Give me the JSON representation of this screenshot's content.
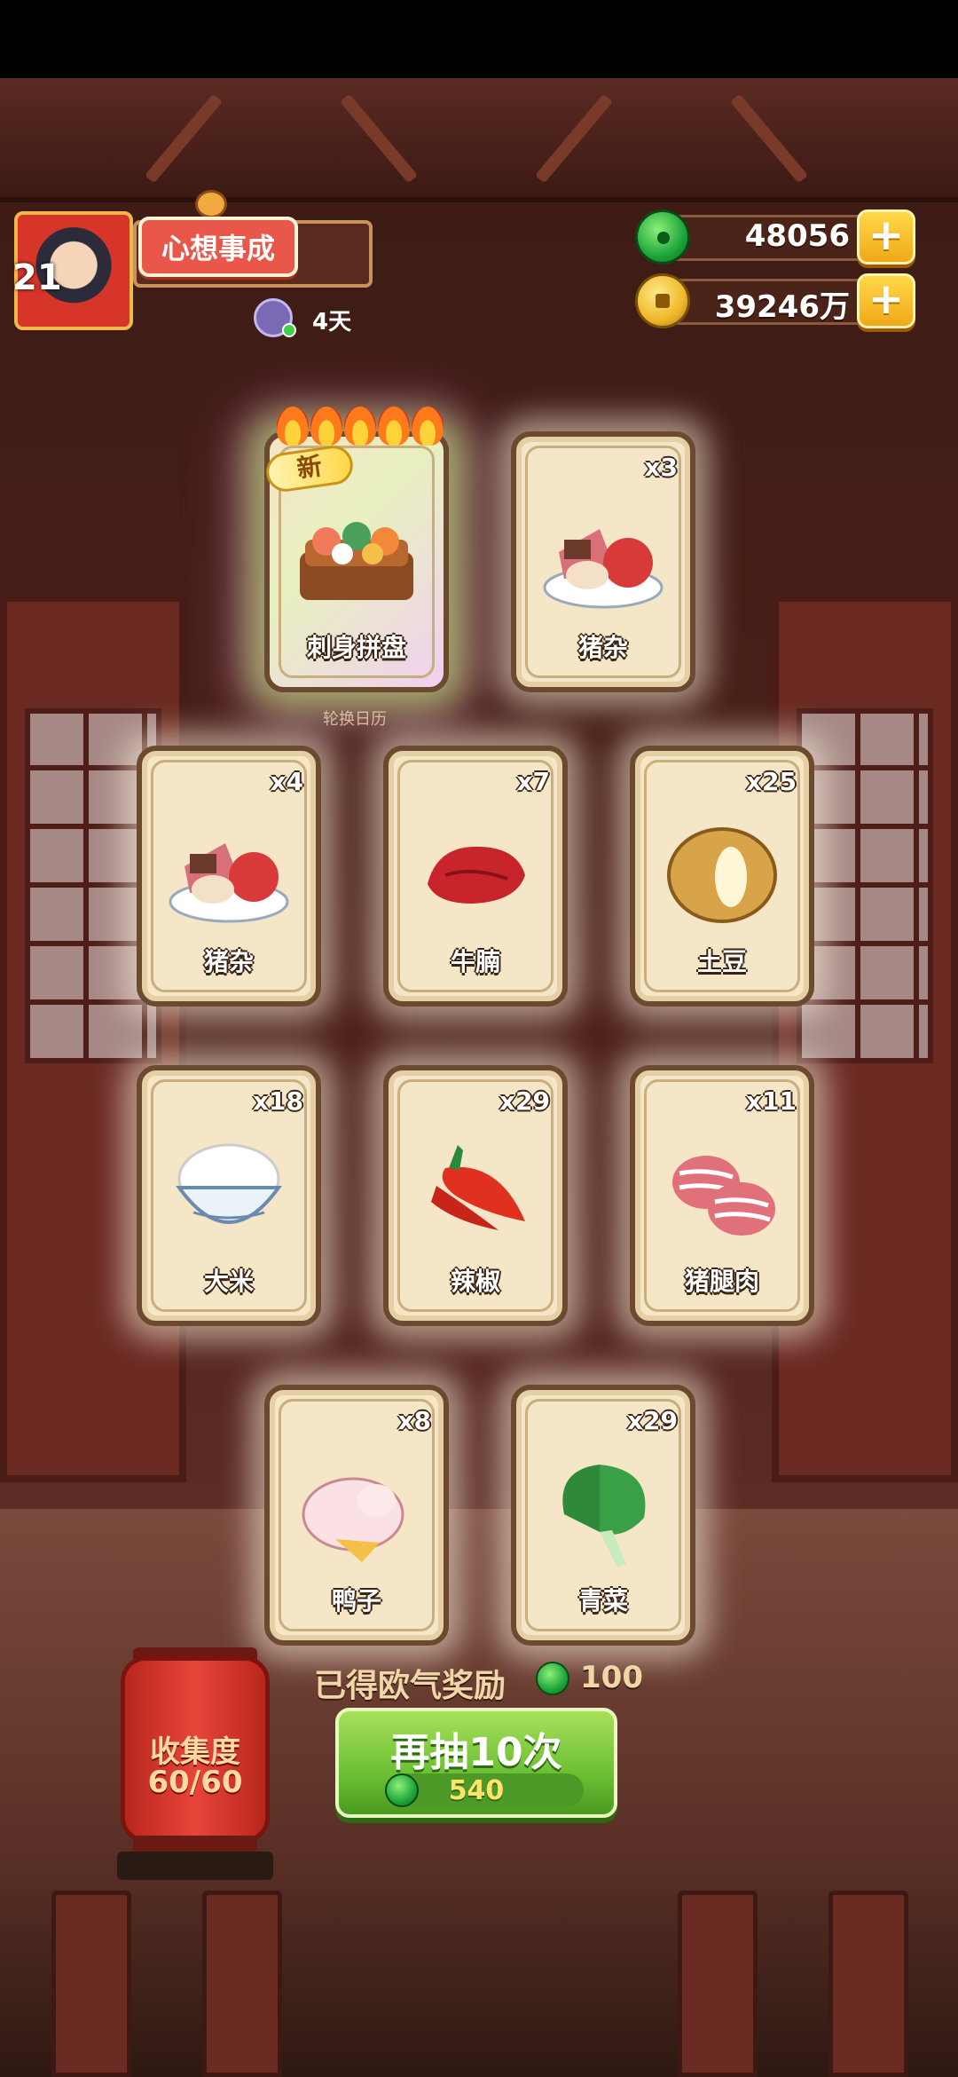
{
  "header": {
    "avatar_level": "21",
    "banner_text": "心想事成",
    "pet_days": "4天"
  },
  "currency": {
    "jade_value": "48056",
    "coin_value": "39246万",
    "plus_label": "+"
  },
  "cards": [
    {
      "name": "刺身拼盘",
      "count": "",
      "tag": "新",
      "flames": 5,
      "icon": "sashimi-platter-icon"
    },
    {
      "name": "猪杂",
      "count": "x3",
      "icon": "pork-offal-icon"
    },
    {
      "name": "猪杂",
      "count": "x4",
      "icon": "pork-offal-icon"
    },
    {
      "name": "牛腩",
      "count": "x7",
      "icon": "beef-brisket-icon"
    },
    {
      "name": "土豆",
      "count": "x25",
      "icon": "potato-icon"
    },
    {
      "name": "大米",
      "count": "x18",
      "icon": "rice-bowl-icon"
    },
    {
      "name": "辣椒",
      "count": "x29",
      "icon": "chili-icon"
    },
    {
      "name": "猪腿肉",
      "count": "x11",
      "icon": "pork-leg-icon"
    },
    {
      "name": "鸭子",
      "count": "x8",
      "icon": "duck-icon"
    },
    {
      "name": "青菜",
      "count": "x29",
      "icon": "greens-icon"
    }
  ],
  "rotate_label": "轮换日历",
  "reward": {
    "label": "已得欧气奖励",
    "value": "100"
  },
  "draw_button": {
    "label": "再抽10次",
    "cost": "540"
  },
  "collection": {
    "label": "收集度",
    "value": "60/60"
  },
  "colors": {
    "accent_green": "#6cc034",
    "jade": "#1ea63a",
    "gold": "#f0b82a",
    "card_bg": "#f4e6c6"
  }
}
